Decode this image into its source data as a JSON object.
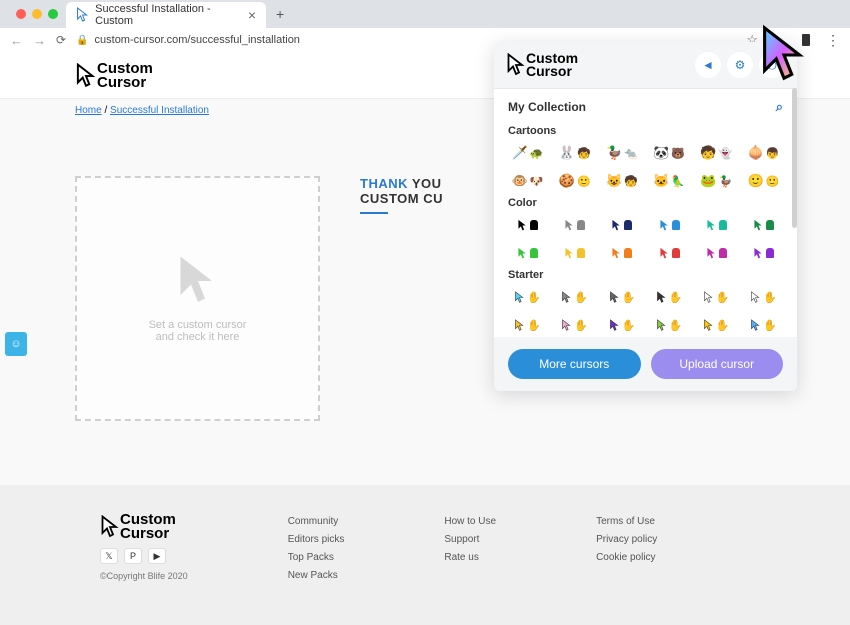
{
  "browser": {
    "tab_title": "Successful Installation - Custom",
    "url": "custom-cursor.com/successful_installation"
  },
  "header": {
    "logo_top": "Custom",
    "logo_bottom": "Cursor"
  },
  "breadcrumb": {
    "home": "Home",
    "current": "Successful Installation"
  },
  "testbox": {
    "line1": "Set a custom cursor",
    "line2": "and check it here"
  },
  "thank": {
    "word1": "THANK",
    "word2": "YOU",
    "line2": "CUSTOM CU"
  },
  "popup": {
    "logo_top": "Custom",
    "logo_bottom": "Cursor",
    "title": "My Collection",
    "sections": {
      "cartoons": "Cartoons",
      "color": "Color",
      "starter": "Starter"
    },
    "more_btn": "More cursors",
    "upload_btn": "Upload cursor"
  },
  "colors": [
    "#000000",
    "#888888",
    "#1b2a6b",
    "#2a8fd8",
    "#1bb99e",
    "#1a8c48",
    "#35c43a",
    "#f4c22b",
    "#f47c1b",
    "#e23b3b",
    "#c22ba8",
    "#8b2bd4"
  ],
  "footer": {
    "logo_top": "Custom",
    "logo_bottom": "Cursor",
    "copyright": "©Copyright Blife 2020",
    "col1": [
      "Community",
      "Editors picks",
      "Top Packs",
      "New Packs"
    ],
    "col2": [
      "How to Use",
      "Support",
      "Rate us"
    ],
    "col3": [
      "Terms of Use",
      "Privacy policy",
      "Cookie policy"
    ]
  }
}
